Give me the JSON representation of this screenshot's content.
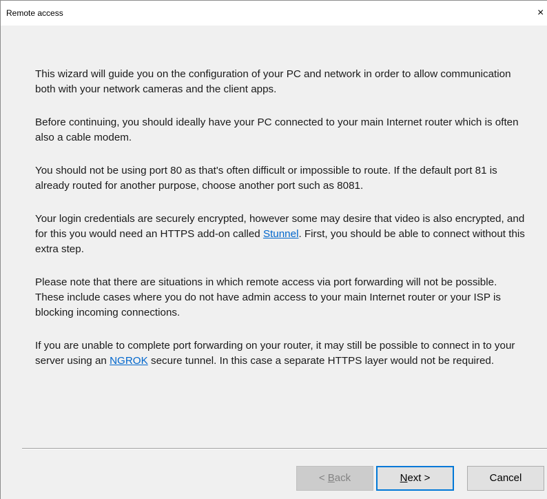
{
  "window": {
    "title": "Remote access",
    "close_glyph": "×"
  },
  "paragraphs": {
    "p1": "This wizard will guide you on the configuration of your PC and network in order to allow communication both with your network cameras and the client apps.",
    "p2": "Before continuing, you should ideally have your PC connected to your main Internet router which is often also a cable modem.",
    "p3": "You should not be using port 80 as that's often difficult or impossible to route.  If the default port 81 is already routed for another purpose, choose another port such as 8081.",
    "p4_before": "Your login credentials are securely encrypted, however some may desire that video is also encrypted, and for this you would need an HTTPS add-on called ",
    "p4_link": "Stunnel",
    "p4_after": ". First, you should be able to connect without this extra step.",
    "p5": "Please note that there are situations in which remote access via port forwarding will not be possible.  These include cases where you do not have admin access to your main Internet router or your ISP is blocking incoming connections.",
    "p6_before": "If you are unable to complete port forwarding on your router, it may still be possible to connect in to your server using an ",
    "p6_link": "NGROK",
    "p6_after": " secure tunnel.  In this case a separate HTTPS layer would not be required."
  },
  "buttons": {
    "back_mnemonic": "B",
    "back_rest": "ack",
    "back_prefix": "< ",
    "next_mnemonic": "N",
    "next_rest": "ext >",
    "cancel": "Cancel"
  }
}
